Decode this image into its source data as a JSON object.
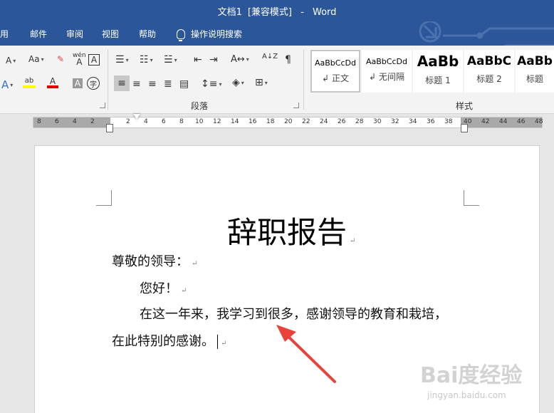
{
  "window": {
    "doc_name": "文档1",
    "mode": "[兼容模式]",
    "separator": "-",
    "app": "Word"
  },
  "menu": {
    "tabs": [
      "用",
      "邮件",
      "审阅",
      "视图",
      "帮助"
    ],
    "tell_me": "操作说明搜索"
  },
  "ribbon": {
    "font_group": {
      "clear_format": "Aa",
      "phonetic_top": "wén",
      "phonetic_bot": "A",
      "char_border": "A",
      "char_shading": "A",
      "enclose": "字"
    },
    "paragraph_group": {
      "label": "段落",
      "sort": "A↓Z"
    },
    "styles_group": {
      "label": "样式",
      "items": [
        {
          "sample": "AaBbCcDd",
          "name": "正文",
          "prefix": "↲"
        },
        {
          "sample": "AaBbCcDd",
          "name": "无间隔",
          "prefix": "↲"
        },
        {
          "sample": "AaBb",
          "name": "标题 1",
          "prefix": ""
        },
        {
          "sample": "AaBbC",
          "name": "标题 2",
          "prefix": ""
        },
        {
          "sample": "AaBb",
          "name": "标题",
          "prefix": ""
        }
      ]
    }
  },
  "ruler": {
    "ticks": [
      "8",
      "6",
      "4",
      "2",
      "2",
      "4",
      "6",
      "8",
      "10",
      "12",
      "14",
      "16",
      "18",
      "20",
      "22",
      "24",
      "26",
      "28",
      "30",
      "32",
      "34",
      "36",
      "38",
      "40",
      "42",
      "44",
      "46",
      "48"
    ]
  },
  "document": {
    "title": "辞职报告",
    "paragraphs": [
      "尊敬的领导：",
      "您好！",
      "在这一年来，我学习到很多，感谢领导的教育和栽培，",
      "在此特别的感谢。"
    ],
    "para_mark": "↵"
  },
  "watermark": {
    "main": "Bai度经验",
    "sub": "jingyan.baidu.com"
  },
  "colors": {
    "ribbon_blue": "#2b579a",
    "arrow_red": "#e8423a",
    "highlight_yellow": "#ffff00",
    "font_red": "#e00000"
  }
}
